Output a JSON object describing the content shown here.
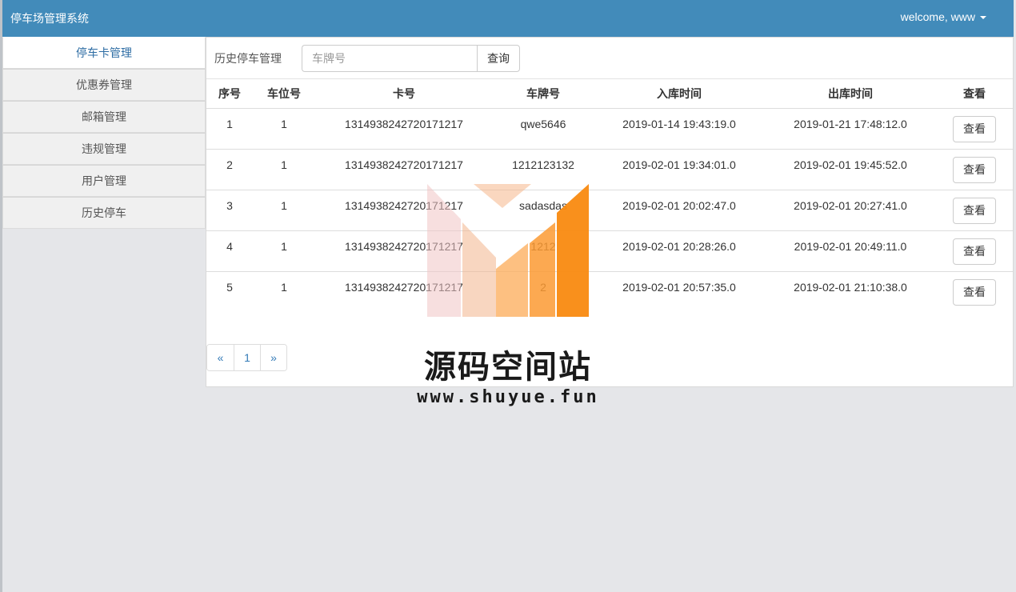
{
  "navbar": {
    "brand": "停车场管理系统",
    "user_label": "welcome, www"
  },
  "sidebar": {
    "items": [
      {
        "label": "停车卡管理",
        "active": true
      },
      {
        "label": "优惠券管理",
        "active": false
      },
      {
        "label": "邮箱管理",
        "active": false
      },
      {
        "label": "违规管理",
        "active": false
      },
      {
        "label": "用户管理",
        "active": false
      },
      {
        "label": "历史停车",
        "active": false
      }
    ]
  },
  "main": {
    "title": "历史停车管理",
    "search": {
      "placeholder": "车牌号",
      "value": "",
      "button_label": "查询"
    },
    "table": {
      "headers": [
        "序号",
        "车位号",
        "卡号",
        "车牌号",
        "入库时间",
        "出库时间",
        "查看"
      ],
      "rows": [
        {
          "seq": "1",
          "space": "1",
          "card": "1314938242720171217",
          "plate": "qwe5646",
          "in_time": "2019-01-14 19:43:19.0",
          "out_time": "2019-01-21 17:48:12.0",
          "action": "查看"
        },
        {
          "seq": "2",
          "space": "1",
          "card": "1314938242720171217",
          "plate": "1212123132",
          "in_time": "2019-02-01 19:34:01.0",
          "out_time": "2019-02-01 19:45:52.0",
          "action": "查看"
        },
        {
          "seq": "3",
          "space": "1",
          "card": "1314938242720171217",
          "plate": "sadasdas",
          "in_time": "2019-02-01 20:02:47.0",
          "out_time": "2019-02-01 20:27:41.0",
          "action": "查看"
        },
        {
          "seq": "4",
          "space": "1",
          "card": "1314938242720171217",
          "plate": "1212",
          "in_time": "2019-02-01 20:28:26.0",
          "out_time": "2019-02-01 20:49:11.0",
          "action": "查看"
        },
        {
          "seq": "5",
          "space": "1",
          "card": "1314938242720171217",
          "plate": "2",
          "in_time": "2019-02-01 20:57:35.0",
          "out_time": "2019-02-01 21:10:38.0",
          "action": "查看"
        }
      ]
    },
    "pagination": {
      "prev": "«",
      "current": "1",
      "next": "»"
    }
  },
  "watermark": {
    "title": "源码空间站",
    "url": "www.shuyue.fun"
  },
  "colors": {
    "navbar": "#428bba",
    "link": "#337ab7",
    "background": "#e5e6e9"
  }
}
